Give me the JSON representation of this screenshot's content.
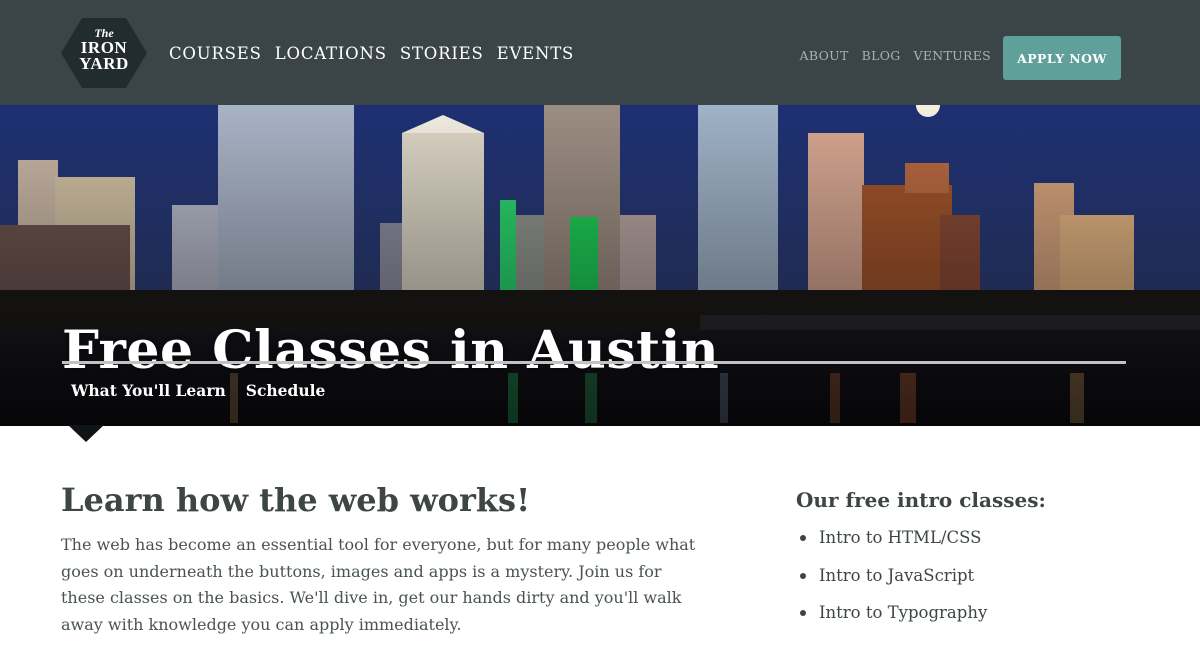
{
  "brand": {
    "logo_line1": "The",
    "logo_line2": "IRON",
    "logo_line3": "YARD"
  },
  "main_nav": [
    {
      "label": "COURSES"
    },
    {
      "label": "LOCATIONS"
    },
    {
      "label": "STORIES"
    },
    {
      "label": "EVENTS"
    }
  ],
  "util_nav": [
    {
      "label": "ABOUT"
    },
    {
      "label": "BLOG"
    },
    {
      "label": "VENTURES"
    }
  ],
  "apply_button": {
    "label": "APPLY NOW"
  },
  "hero": {
    "title": "Free Classes in Austin",
    "tabs": [
      {
        "label": "What You'll Learn",
        "active": true
      },
      {
        "label": "Schedule",
        "active": false
      }
    ]
  },
  "main": {
    "title": "Learn how the web works!",
    "body": "The web has become an essential tool for everyone, but for many people what goes on underneath the buttons, images and apps is a mystery. Join us for these classes on the basics. We'll dive in, get our hands dirty and you'll walk away with knowledge you can apply immediately."
  },
  "sidebar": {
    "title": "Our free intro classes:",
    "items": [
      {
        "label": "Intro to HTML/CSS"
      },
      {
        "label": "Intro to JavaScript"
      },
      {
        "label": "Intro to Typography"
      }
    ]
  },
  "colors": {
    "header_bg": "#3b4548",
    "accent": "#60a09a",
    "text": "#3d4545"
  }
}
